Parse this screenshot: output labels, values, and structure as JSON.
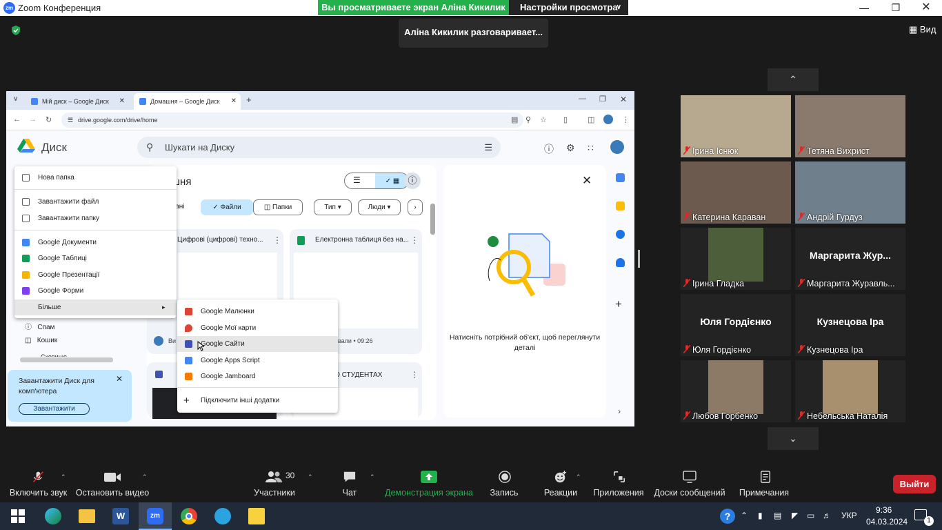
{
  "app": {
    "title": "Zoom Конференция",
    "logo_text": "zm"
  },
  "banner": {
    "sharing": "Вы просматриваете экран Аліна Кикилик",
    "view_settings": "Настройки просмотра"
  },
  "speaking": "Аліна Кикилик разговаривает...",
  "view_button": "Вид",
  "browser": {
    "tabs": [
      {
        "label": "Мій диск – Google Диск",
        "active": false
      },
      {
        "label": "Домашня – Google Диск",
        "active": true
      }
    ],
    "url": "drive.google.com/drive/home"
  },
  "drive": {
    "title": "Диск",
    "search_placeholder": "Шукати на Диску",
    "page_heading": "шня",
    "filter_left": "вані",
    "toggle_files": "Файли",
    "toggle_folders": "Папки",
    "filters": [
      "Тип",
      "Люди"
    ],
    "card1_title": "Цифрові (цифрові) техно...",
    "card2_title": "Електронна таблиця без на...",
    "card2_meta": "вали • 09:26",
    "card3_title": "И ПО СТУДЕНТАХ",
    "card1_footer": "Ви",
    "details_hint": "Натисніть потрібний об'єкт, щоб переглянути деталі",
    "sidebar_items": [
      "Спам",
      "Кошик"
    ],
    "sidebar_more": "Сховище",
    "download_banner": {
      "text": "Завантажити Диск для комп'ютера",
      "button": "Завантажити"
    }
  },
  "new_menu": {
    "items": [
      {
        "label": "Нова папка",
        "icon": "folder-plus-icon",
        "color": "#5f6368"
      },
      {
        "label": "Завантажити файл",
        "icon": "file-upload-icon",
        "color": "#5f6368"
      },
      {
        "label": "Завантажити папку",
        "icon": "folder-upload-icon",
        "color": "#5f6368"
      },
      {
        "label": "Google Документи",
        "icon": "docs-icon",
        "color": "#4285f4"
      },
      {
        "label": "Google Таблиці",
        "icon": "sheets-icon",
        "color": "#0f9d58"
      },
      {
        "label": "Google Презентації",
        "icon": "slides-icon",
        "color": "#f4b400"
      },
      {
        "label": "Google Форми",
        "icon": "forms-icon",
        "color": "#7e3ff2"
      }
    ],
    "more": "Більше"
  },
  "sub_menu": {
    "items": [
      {
        "label": "Google Малюнки",
        "icon": "drawings-icon",
        "color": "#db4437"
      },
      {
        "label": "Google Мої карти",
        "icon": "mymaps-icon",
        "color": "#db4437"
      },
      {
        "label": "Google Сайти",
        "icon": "sites-icon",
        "color": "#3f51b5"
      },
      {
        "label": "Google Apps Script",
        "icon": "apps-script-icon",
        "color": "#4285f4"
      },
      {
        "label": "Google Jamboard",
        "icon": "jamboard-icon",
        "color": "#f57c00"
      }
    ],
    "connect": "Підключити інші додатки"
  },
  "participants": [
    {
      "name": "Ірина Існюк",
      "big": ""
    },
    {
      "name": "Тетяна Вихрист",
      "big": ""
    },
    {
      "name": "Катерина Караван",
      "big": ""
    },
    {
      "name": "Андрій Гурдуз",
      "big": ""
    },
    {
      "name": "Ірина Гладка",
      "big": ""
    },
    {
      "name": "Маргарита Журавль...",
      "big": "Маргарита  Жур..."
    },
    {
      "name": "Юля Гордієнко",
      "big": "Юля Гордієнко"
    },
    {
      "name": "Кузнецова Іра",
      "big": "Кузнецова Іра"
    },
    {
      "name": "Любов Горбенко",
      "big": ""
    },
    {
      "name": "Небельська Наталія",
      "big": ""
    }
  ],
  "toolbar": {
    "unmute": "Включить звук",
    "stop_video": "Остановить видео",
    "participants": "Участники",
    "participants_count": "30",
    "chat": "Чат",
    "share": "Демонстрация экрана",
    "record": "Запись",
    "reactions": "Реакции",
    "apps": "Приложения",
    "whiteboards": "Доски сообщений",
    "notes": "Примечания",
    "leave": "Выйти"
  },
  "taskbar": {
    "lang": "УКР",
    "time": "9:36",
    "date": "04.03.2024",
    "notifications": "1"
  },
  "colors": {
    "share_green": "#24b04b",
    "leave_red": "#c8222b",
    "drive_blue": "#c2e7ff",
    "taskbar": "#202a39"
  }
}
